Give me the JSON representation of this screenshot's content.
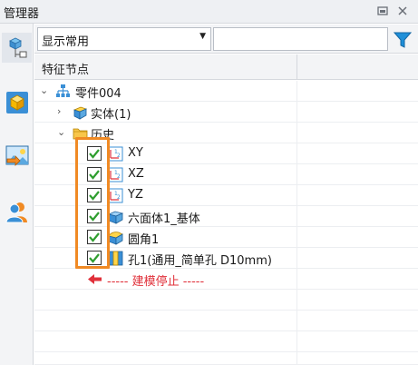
{
  "panel": {
    "title": "管理器"
  },
  "toolbar": {
    "filter_value": "显示常用",
    "search_value": ""
  },
  "tree": {
    "column_header": "特征节点",
    "root": {
      "label": "零件004"
    },
    "solid": {
      "label": "实体(1)"
    },
    "history": {
      "label": "历史"
    },
    "features": [
      {
        "label": "XY",
        "icon": "datum-plane-icon",
        "checked": true
      },
      {
        "label": "XZ",
        "icon": "datum-plane-icon",
        "checked": true
      },
      {
        "label": "YZ",
        "icon": "datum-plane-icon",
        "checked": true
      },
      {
        "label": "六面体1_基体",
        "icon": "box-icon",
        "checked": true
      },
      {
        "label": "圆角1",
        "icon": "fillet-icon",
        "checked": true
      },
      {
        "label": "孔1(通用_简单孔 D10mm)",
        "icon": "hole-icon",
        "checked": true
      }
    ],
    "stop_marker": {
      "label": "----- 建模停止 -----",
      "icon": "red-arrow-left-icon"
    }
  },
  "colors": {
    "highlight": "#f08a24",
    "stop_text": "#e0303a",
    "check": "#2f9e2f"
  }
}
